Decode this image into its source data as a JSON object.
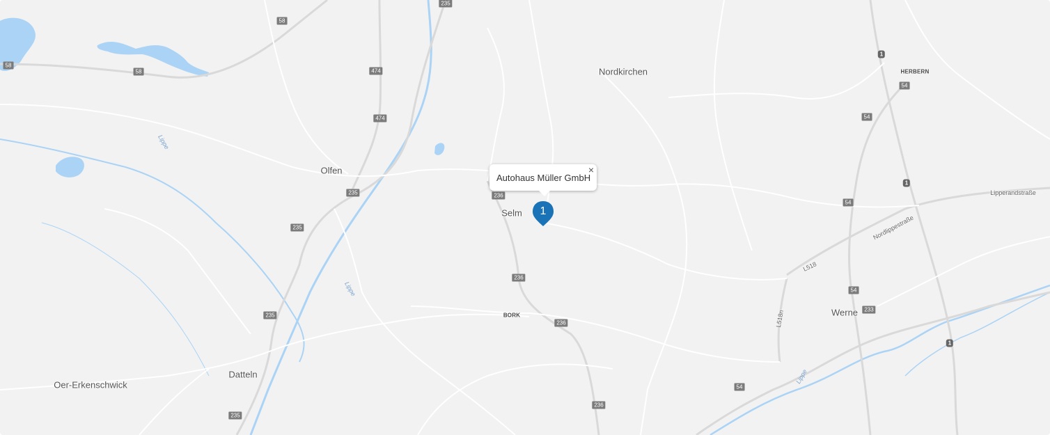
{
  "colors": {
    "land": "#f2f2f2",
    "road": "#ffffff",
    "major_road": "#dadada",
    "water": "#aad3f5",
    "marker": "#1a73b6"
  },
  "towns": [
    {
      "id": "nordkirchen",
      "label": "Nordkirchen"
    },
    {
      "id": "olfen",
      "label": "Olfen"
    },
    {
      "id": "selm",
      "label": "Selm"
    },
    {
      "id": "werne",
      "label": "Werne"
    },
    {
      "id": "datteln",
      "label": "Datteln"
    },
    {
      "id": "oer",
      "label": "Oer-Erkenschwick"
    }
  ],
  "small_labels": [
    {
      "id": "herbern",
      "label": "HERBERN"
    },
    {
      "id": "bork",
      "label": "BORK"
    }
  ],
  "street_labels": [
    {
      "id": "lipperandstrasse",
      "label": "Lipperandstraße"
    },
    {
      "id": "nordlippestrasse",
      "label": "Nordlippestraße"
    },
    {
      "id": "l518",
      "label": "L518"
    },
    {
      "id": "l518n",
      "label": "L518n"
    }
  ],
  "river_labels": [
    {
      "id": "lippe1",
      "label": "Lippe"
    },
    {
      "id": "lippe2",
      "label": "Lippe"
    },
    {
      "id": "lippe3",
      "label": "Lippe"
    }
  ],
  "shields": [
    "235",
    "58",
    "58",
    "58",
    "474",
    "474",
    "235",
    "235",
    "235",
    "235",
    "236",
    "236",
    "236",
    "236",
    "54",
    "54",
    "54",
    "54",
    "54",
    "233",
    "1",
    "1",
    "1"
  ],
  "popup": {
    "title": "Autohaus Müller GmbH",
    "close_icon": "×"
  },
  "marker": {
    "label": "1"
  }
}
